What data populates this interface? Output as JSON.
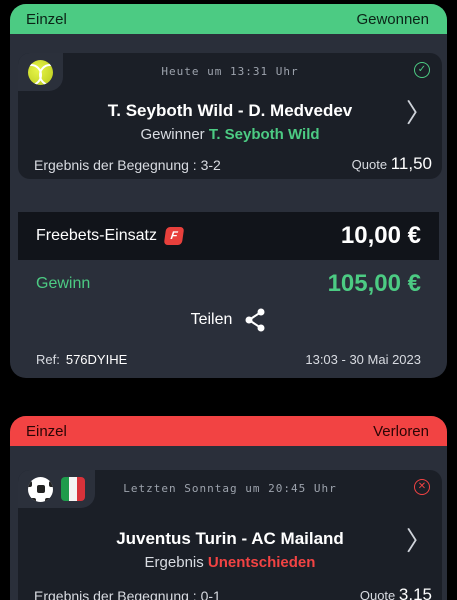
{
  "bets": [
    {
      "type_label": "Einzel",
      "status_label": "Gewonnen",
      "time": "Heute um 13:31 Uhr",
      "match": "T. Seyboth Wild - D. Medvedev",
      "market_label": "Gewinner",
      "selection": "T. Seyboth Wild",
      "result_label": "Ergebnis der Begegnung : 3-2",
      "quote_label": "Quote",
      "quote_value": "11,50",
      "stake_label": "Freebets-Einsatz",
      "stake_value": "10,00 €",
      "gain_label": "Gewinn",
      "gain_value": "105,00 €",
      "share_label": "Teilen",
      "ref_label": "Ref:",
      "ref_value": "576DYIHE",
      "datetime": "13:03 - 30 Mai 2023"
    },
    {
      "type_label": "Einzel",
      "status_label": "Verloren",
      "time": "Letzten Sonntag um 20:45 Uhr",
      "match": "Juventus Turin - AC Mailand",
      "market_label": "Ergebnis",
      "selection": "Unentschieden",
      "result_label": "Ergebnis der Begegnung : 0-1",
      "quote_label": "Quote",
      "quote_value": "3,15"
    }
  ],
  "icons": {
    "tennis": "tennis-ball-icon",
    "soccer": "soccer-ball-icon",
    "flag": "italy-flag-icon",
    "won": "check-circle-icon",
    "lost": "x-circle-icon",
    "freebet": "freebet-badge-icon",
    "share": "share-icon",
    "chevron": "chevron-right-icon"
  },
  "colors": {
    "won": "#4ccb83",
    "lost": "#f24343",
    "card": "#2a2f3a",
    "inner": "#1b1f27"
  }
}
